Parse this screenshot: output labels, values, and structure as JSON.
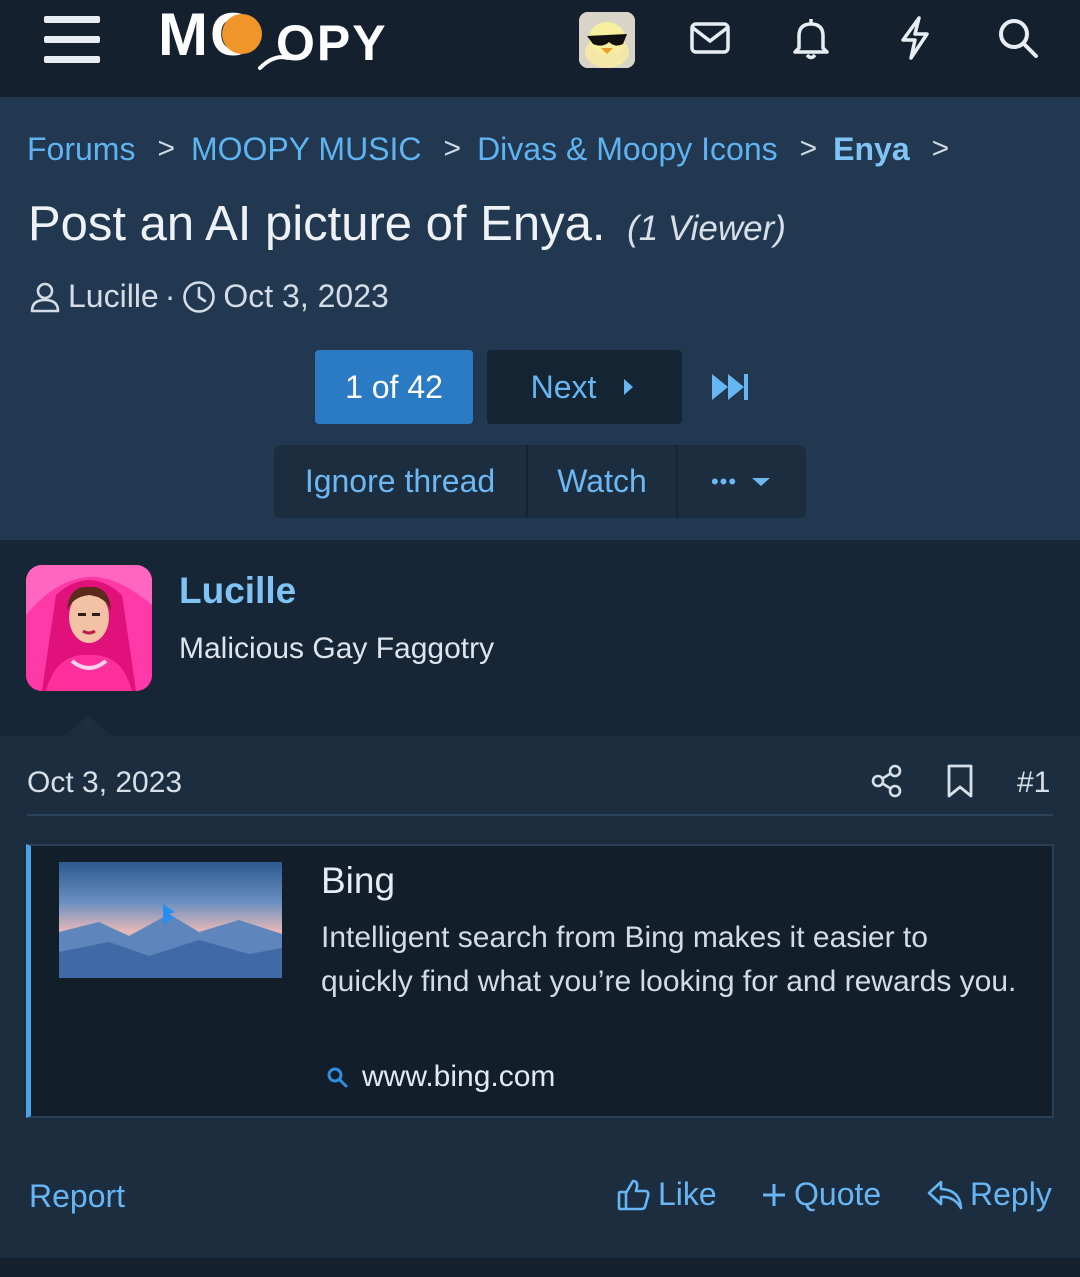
{
  "topbar": {
    "logo_text_left": "MO",
    "logo_text_right": "OPY",
    "icons": [
      "menu-icon",
      "avatar",
      "mail-icon",
      "bell-icon",
      "bolt-icon",
      "search-icon"
    ]
  },
  "breadcrumbs": [
    {
      "label": "Forums"
    },
    {
      "label": "MOOPY MUSIC"
    },
    {
      "label": "Divas & Moopy Icons"
    },
    {
      "label": "Enya"
    }
  ],
  "thread": {
    "title": "Post an AI picture of Enya.",
    "viewers": "(1 Viewer)",
    "author": "Lucille",
    "separator": "·",
    "date": "Oct 3, 2023"
  },
  "pagination": {
    "current": "1 of 42",
    "next_label": "Next"
  },
  "thread_actions": {
    "ignore": "Ignore thread",
    "watch": "Watch",
    "more": "•••"
  },
  "post": {
    "author_name": "Lucille",
    "author_title": "Malicious Gay Faggotry",
    "date": "Oct 3, 2023",
    "number": "#1",
    "embed": {
      "title": "Bing",
      "description": "Intelligent search from Bing makes it easier to quickly find what you’re looking for and rewards you.",
      "url": "www.bing.com"
    },
    "footer": {
      "report": "Report",
      "like": "Like",
      "quote": "Quote",
      "reply": "Reply"
    }
  },
  "colors": {
    "topbar_bg": "#14202d",
    "header_bg": "#213850",
    "accent": "#2a7bc3",
    "link": "#67b6f3",
    "logo_dot": "#f0952a"
  }
}
